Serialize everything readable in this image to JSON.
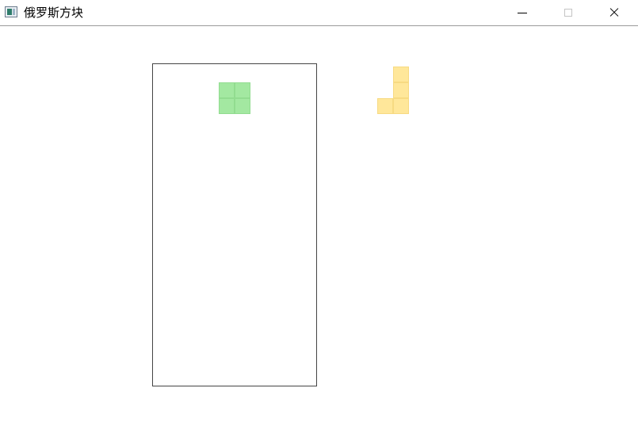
{
  "window": {
    "title": "俄罗斯方块",
    "icon": "app-window-icon",
    "buttons": {
      "minimize": "minimize-icon",
      "maximize": "maximize-icon",
      "close": "close-icon"
    }
  },
  "game": {
    "current_piece": {
      "shape": "O",
      "color": "#a3e8a1"
    },
    "next_piece": {
      "shape": "J",
      "color": "#ffe79a"
    }
  }
}
